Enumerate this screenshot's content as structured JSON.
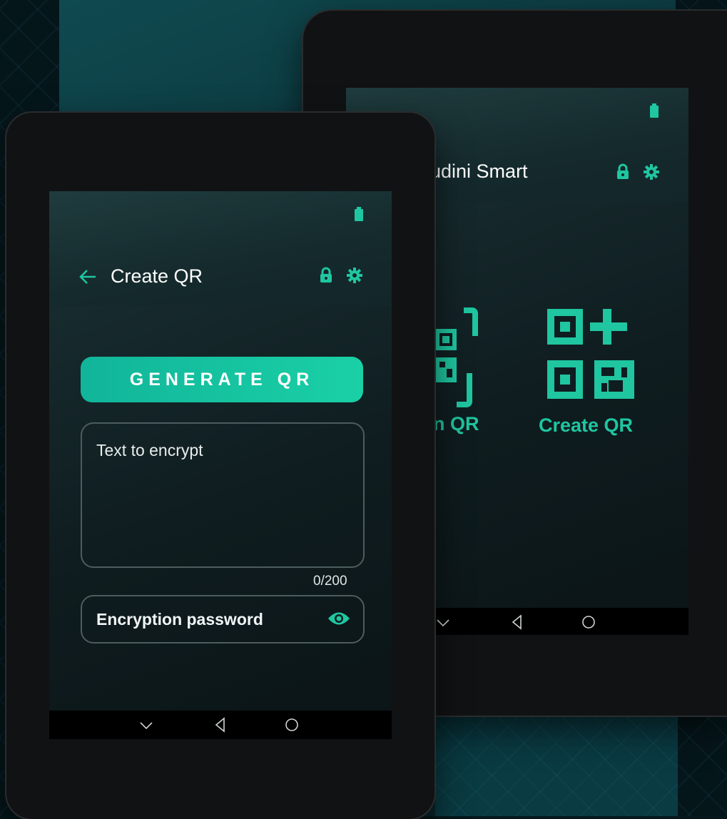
{
  "back_device": {
    "app_title": "udini Smart",
    "tiles": [
      {
        "label": "n QR",
        "icon": "scan-qr-icon"
      },
      {
        "label": "Create QR",
        "icon": "create-qr-icon"
      }
    ],
    "icons": {
      "lock": "lock-icon",
      "settings": "gear-icon",
      "battery": "battery-icon"
    }
  },
  "front_device": {
    "screen_title": "Create QR",
    "generate_button": "GENERATE QR",
    "text_placeholder": "Text to encrypt",
    "char_counter": "0/200",
    "password_placeholder": "Encryption password",
    "icons": {
      "back": "back-arrow-icon",
      "lock": "lock-icon",
      "settings": "gear-icon",
      "visibility": "eye-icon",
      "battery": "battery-icon"
    }
  },
  "nav_bar": {
    "icons": [
      "chevron-down-icon",
      "back-triangle-icon",
      "home-circle-icon"
    ]
  },
  "colors": {
    "accent": "#1fc6a0",
    "background": "#06181c",
    "screen_dark": "#0f1d20",
    "nav_bar": "#000000"
  }
}
